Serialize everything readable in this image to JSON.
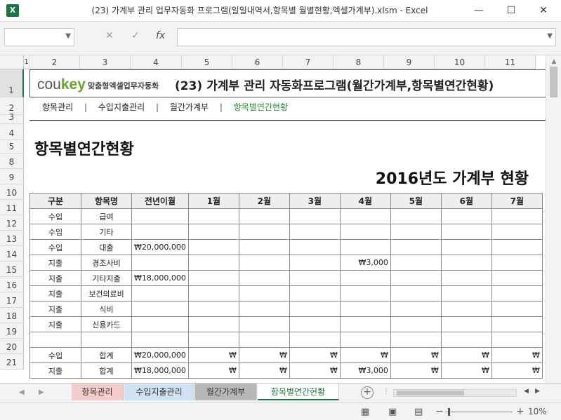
{
  "window": {
    "title": "(23) 가계부 관리 업무자동화 프로그램(일일내역서,항목별 월별현황,엑셀가계부).xlsm - Excel",
    "app_icon_letter": "X",
    "minimize": "—",
    "maximize": "☐",
    "close": "✕"
  },
  "formula_bar": {
    "name_box": "",
    "formula": "",
    "cancel_icon": "✕",
    "enter_icon": "✓",
    "fx_icon": "fx"
  },
  "columns": [
    "1",
    "2",
    "3",
    "4",
    "5",
    "6",
    "7",
    "8",
    "9",
    "10",
    "11"
  ],
  "rows": [
    "1",
    "2",
    "3",
    "4",
    "5",
    "8",
    "9",
    "10",
    "11",
    "12",
    "13",
    "14",
    "15",
    "16",
    "17",
    "18",
    "19",
    "20",
    "21"
  ],
  "header": {
    "brand_co": "cou",
    "brand_key": "key",
    "brand_sub": "맞춤형엑셀업무자동화",
    "title": "(23) 가계부 관리 자동화프로그램(월간가계부,항목별연간현황)"
  },
  "nav": [
    {
      "label": "항목관리",
      "active": false
    },
    {
      "label": "수입지출관리",
      "active": false
    },
    {
      "label": "월간가계부",
      "active": false
    },
    {
      "label": "항목별연간현황",
      "active": true
    }
  ],
  "nav_separator": "|",
  "section_title": "항목별연간현황",
  "year_title": "2016년도 가계부 현황",
  "table": {
    "headers": [
      "구분",
      "항목명",
      "전년이월",
      "1월",
      "2월",
      "3월",
      "4월",
      "5월",
      "6월",
      "7월"
    ],
    "rows": [
      [
        "수입",
        "급여",
        "",
        "",
        "",
        "",
        "",
        "",
        "",
        ""
      ],
      [
        "수입",
        "기타",
        "",
        "",
        "",
        "",
        "",
        "",
        "",
        ""
      ],
      [
        "수입",
        "대출",
        "₩20,000,000",
        "",
        "",
        "",
        "",
        "",
        "",
        ""
      ],
      [
        "지출",
        "경조사비",
        "",
        "",
        "",
        "",
        "₩3,000",
        "",
        "",
        ""
      ],
      [
        "지출",
        "기타지출",
        "₩18,000,000",
        "",
        "",
        "",
        "",
        "",
        "",
        ""
      ],
      [
        "지출",
        "보건의료비",
        "",
        "",
        "",
        "",
        "",
        "",
        "",
        ""
      ],
      [
        "지출",
        "식비",
        "",
        "",
        "",
        "",
        "",
        "",
        "",
        ""
      ],
      [
        "지출",
        "신용카드",
        "",
        "",
        "",
        "",
        "",
        "",
        "",
        ""
      ]
    ],
    "totals": [
      [
        "수입",
        "합계",
        "₩20,000,000",
        "₩",
        "₩",
        "₩",
        "₩",
        "₩",
        "₩",
        "₩"
      ],
      [
        "지출",
        "합계",
        "₩18,000,000",
        "₩",
        "₩",
        "₩",
        "₩3,000",
        "₩",
        "₩",
        "₩"
      ]
    ]
  },
  "sheet_tabs": [
    {
      "label": "항목관리",
      "color": "#f4cccc"
    },
    {
      "label": "수입지출관리",
      "color": "#cfe2f3"
    },
    {
      "label": "월간가계부",
      "color": "#b7b7b7"
    },
    {
      "label": "항목별연간현황",
      "color": "#ffffff",
      "active": true
    }
  ],
  "add_sheet": "+",
  "status": {
    "zoom_level": "10%",
    "zoom_minus": "−",
    "zoom_plus": "+"
  }
}
